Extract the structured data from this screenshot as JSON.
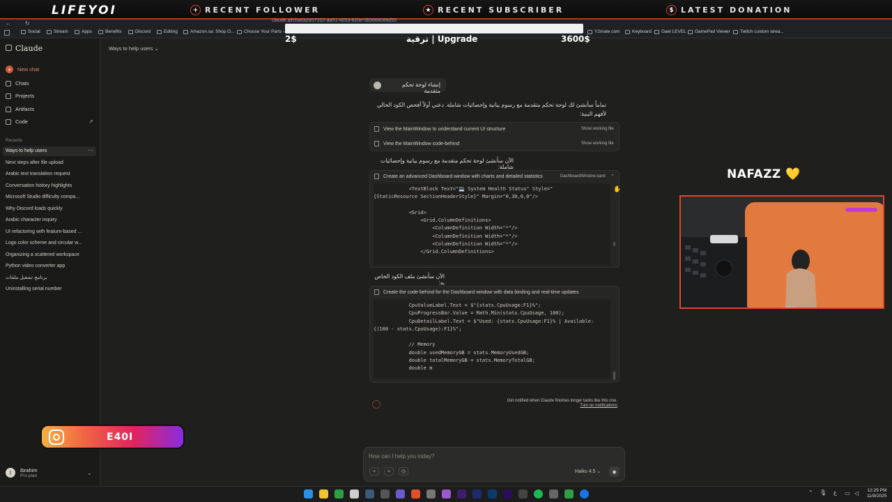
{
  "overlay": {
    "brand": "LIFEYOI",
    "recent_follower": "RECENT FOLLOWER",
    "recent_subscriber": "RECENT SUBSCRIBER",
    "latest_donation": "LATEST DONATION",
    "goal_left": "2$",
    "goal_center": "ترقية | Upgrade",
    "goal_right": "3600$",
    "streamer_name": "NAFAZZ 💛",
    "instagram_handle": "E40I"
  },
  "browser": {
    "url": "claude.ai/chat/a2a57202-aa51-4053-820e-0b5668089d55",
    "bookmarks": [
      "Social",
      "Stream",
      "Apps",
      "Benefits",
      "Discord",
      "Editing",
      "Amazon.sa: Shop O...",
      "Choose Your Parts -...",
      "Y2mate.com",
      "Keyboard",
      "Gael LEVEL",
      "GamePad Viewer",
      "Twitch custom strea..."
    ]
  },
  "sidebar": {
    "app_title": "Claude",
    "new_chat": "New chat",
    "nav": [
      "Chats",
      "Projects",
      "Artifacts",
      "Code"
    ],
    "recents_label": "Recents",
    "recents": [
      "Ways to help users",
      "Next steps after file upload",
      "Arabic text translation request",
      "Conversation history highlights",
      "Microsoft Studio difficulty compa...",
      "Why Discord loads quickly",
      "Arabic character inquiry",
      "UI refactoring with feature-based ...",
      "Logo color scheme and circular w...",
      "Organizing a scattered workspace",
      "Python video converter app",
      "برنامج تشغيل ملفات",
      "Uninstalling serial number"
    ],
    "user_name": "ibrahim",
    "user_plan": "Pro plan",
    "user_initial": "I"
  },
  "chat": {
    "title": "Ways to help users",
    "user_message": "إنشاء لوحة تحكم متقدمة",
    "assistant_intro": "تماماً سأنشئ لك لوحة تحكم متقدمة مع رسوم بيانية وإحصائيات شاملة. دعني أولاً أفحص الكود الحالي لأفهم البنية:",
    "tool_calls": [
      {
        "label": "View the MainWindow to understand current UI structure",
        "action": "Show working file"
      },
      {
        "label": "View the MainWindow code-behind",
        "action": "Show working file"
      }
    ],
    "assistant_msg2": "الآن سأنشئ لوحة تحكم متقدمة مع رسوم بيانية وإحصائيات شاملة:",
    "artifact1_title": "Create an advanced Dashboard window with charts and detailed statistics",
    "artifact1_file": "DashboardWindow.xaml",
    "code1": "            <TextBlock Text=\"💻 System Health Status\" Style=\"\n{StaticResource SectionHeaderStyle}\" Margin=\"0,30,0,0\"/>\n\n            <Grid>\n                <Grid.ColumnDefinitions>\n                    <ColumnDefinition Width=\"*\"/>\n                    <ColumnDefinition Width=\"*\"/>\n                    <ColumnDefinition Width=\"*\"/>\n                </Grid.ColumnDefinitions>",
    "assistant_msg3": "الآن سأنشئ ملف الكود الخاص به:",
    "artifact2_title": "Create the code-behind for the Dashboard window with data binding and real-time updates",
    "code2": "            CpuValueLabel.Text = $\"{stats.CpuUsage:F1}%\";\n            CpuProgressBar.Value = Math.Min(stats.CpuUsage, 100);\n            CpuDetailLabel.Text = $\"Used: {stats.CpuUsage:F1}% | Available:\n{(100 - stats.CpuUsage):F1}%\";\n\n            // Memory\n            double usedMemoryGB = stats.MemoryUsedGB;\n            double totalMemoryGB = stats.MemoryTotalGB;\n            double m",
    "notify_text": "Get notified when Claude finishes longer tasks like this one.",
    "notify_link": "Turn on notifications"
  },
  "composer": {
    "placeholder": "How can I help you today?",
    "model": "Haiku 4.5"
  },
  "taskbar": {
    "time": "12:29 PM",
    "date": "11/9/2025",
    "lang": "ع"
  },
  "colors": {
    "accent": "#d0573b",
    "overlay_red": "#e0472c",
    "bg": "#1f1f1e"
  }
}
